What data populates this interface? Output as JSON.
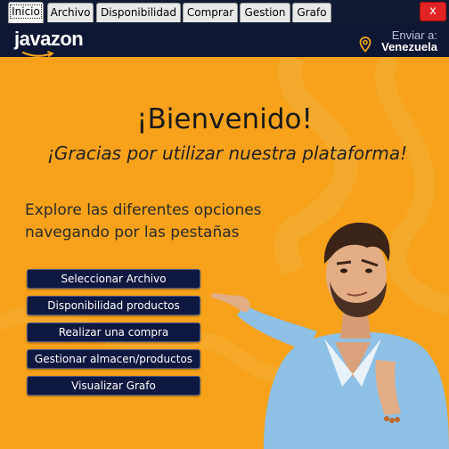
{
  "tabs": [
    {
      "label": "Inicio",
      "active": true
    },
    {
      "label": "Archivo",
      "active": false
    },
    {
      "label": "Disponibilidad",
      "active": false
    },
    {
      "label": "Comprar",
      "active": false
    },
    {
      "label": "Gestion",
      "active": false
    },
    {
      "label": "Grafo",
      "active": false
    }
  ],
  "window": {
    "close_label": "x"
  },
  "header": {
    "logo": "javazon",
    "ship_label": "Enviar a:",
    "ship_country": "Venezuela"
  },
  "main": {
    "title": "¡Bienvenido!",
    "subtitle": "¡Gracias por utilizar nuestra plataforma!",
    "explore_line1": "Explore las diferentes  opciones",
    "explore_line2": "navegando por las pestañas",
    "buttons": [
      "Seleccionar Archivo",
      "Disponibilidad productos",
      "Realizar una compra",
      "Gestionar almacen/productos",
      "Visualizar Grafo"
    ]
  },
  "colors": {
    "background": "#f7a21a",
    "header": "#0d1633",
    "button": "#0f1840",
    "close": "#e22323"
  }
}
